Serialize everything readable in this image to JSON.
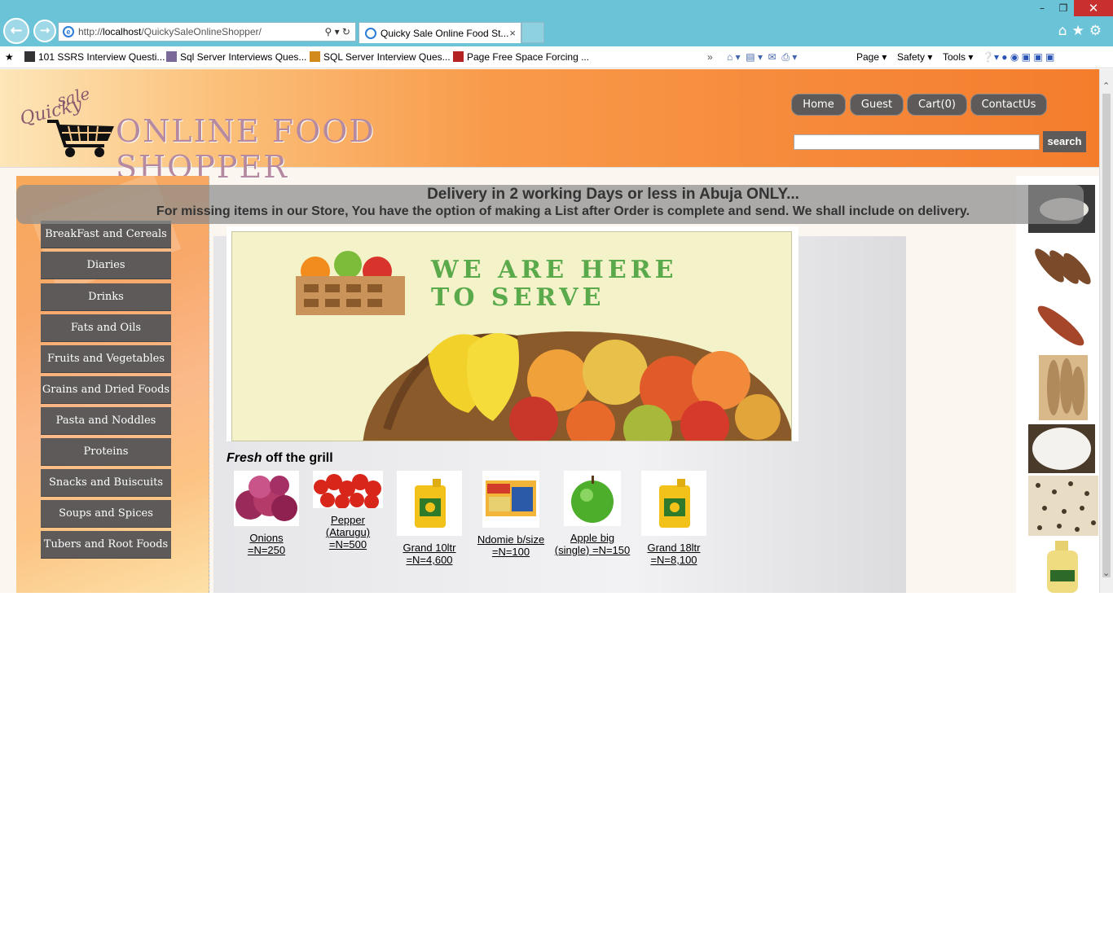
{
  "browser": {
    "address": "http://localhost/QuickySaleOnlineShopper/",
    "address_protocol": "http://",
    "address_host": "localhost",
    "address_path": "/QuickySaleOnlineShopper/",
    "tab_title": "Quicky Sale Online Food St...",
    "tab_close": "×",
    "window_min": "–",
    "window_max": "❐",
    "window_close": "✕",
    "chrome_icons": "⌂★⚙",
    "favorites": [
      {
        "label": "101 SSRS Interview Questi...",
        "icon_color": "#333"
      },
      {
        "label": "Sql Server Interviews Ques...",
        "icon_color": "#7a6a9a"
      },
      {
        "label": "SQL Server Interview Ques...",
        "icon_color": "#d28a1a"
      },
      {
        "label": "Page Free Space  Forcing ...",
        "icon_color": "#b52222"
      }
    ],
    "command_bar": [
      "Page ▾",
      "Safety ▾",
      "Tools ▾"
    ]
  },
  "site": {
    "logo": {
      "sale": "sale",
      "quicky": "Quicky",
      "brand": "ONLINE FOOD SHOPPER"
    },
    "top_nav": [
      "Home",
      "Guest",
      "Cart(0)",
      "ContactUs"
    ],
    "search": {
      "value": "",
      "button": "search"
    },
    "delivery_line1": "Delivery in 2 working Days or less in Abuja ONLY...",
    "delivery_line2": "For missing items in our Store, You have the option of making a List after Order is complete and send. We shall include on delivery.",
    "categories": [
      "BreakFast and Cereals",
      "Diaries",
      "Drinks",
      "Fats and Oils",
      "Fruits and Vegetables",
      "Grains and Dried Foods",
      "Pasta and Noddles",
      "Proteins",
      "Snacks and Buiscuits",
      "Soups and Spices",
      "Tubers and Root Foods"
    ],
    "banner_text_1": "WE ARE HERE",
    "banner_text_2": "TO SERVE",
    "fresh_word": "Fresh",
    "fresh_rest": " off the grill",
    "products": [
      {
        "line1": "Onions =N=250",
        "line2": "",
        "line3": ""
      },
      {
        "line1": "Pepper",
        "line2": "(Atarugu)",
        "line3": "=N=500"
      },
      {
        "line1": "Grand 10ltr",
        "line2": "=N=4,600",
        "line3": ""
      },
      {
        "line1": "Ndomie b/size",
        "line2": "=N=100",
        "line3": ""
      },
      {
        "line1": "Apple big",
        "line2": "(single) =N=150",
        "line3": ""
      },
      {
        "line1": "Grand 18ltr",
        "line2": "=N=8,100",
        "line3": ""
      }
    ]
  },
  "colors": {
    "menu_button": "#5d5a59",
    "header_orange": "#f6893a",
    "browser_frame": "#6bc3d8",
    "close_red": "#c7302f"
  }
}
